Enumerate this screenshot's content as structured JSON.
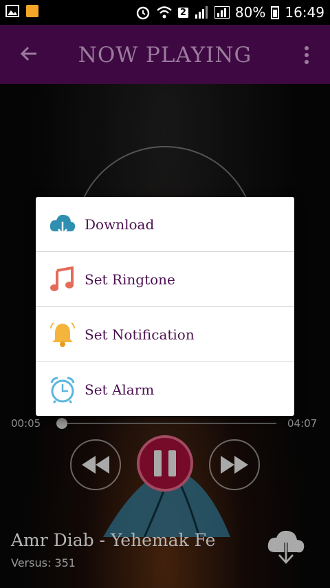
{
  "status_bar": {
    "sim_badge": "2",
    "battery_percent": "80%",
    "time": "16:49"
  },
  "app_bar": {
    "title": "NOW PLAYING",
    "accent_color": "#3e0942"
  },
  "menu": {
    "items": [
      {
        "label": "Download",
        "icon": "cloud-download-icon"
      },
      {
        "label": "Set Ringtone",
        "icon": "music-note-icon"
      },
      {
        "label": "Set Notification",
        "icon": "bell-icon"
      },
      {
        "label": "Set Alarm",
        "icon": "alarm-clock-icon"
      }
    ]
  },
  "player": {
    "elapsed": "00:05",
    "duration": "04:07",
    "progress": 0.02,
    "song_title": "Amr Diab - Yehemak Fe",
    "versus": "Versus: 351",
    "accent_color": "#8f0e32"
  }
}
